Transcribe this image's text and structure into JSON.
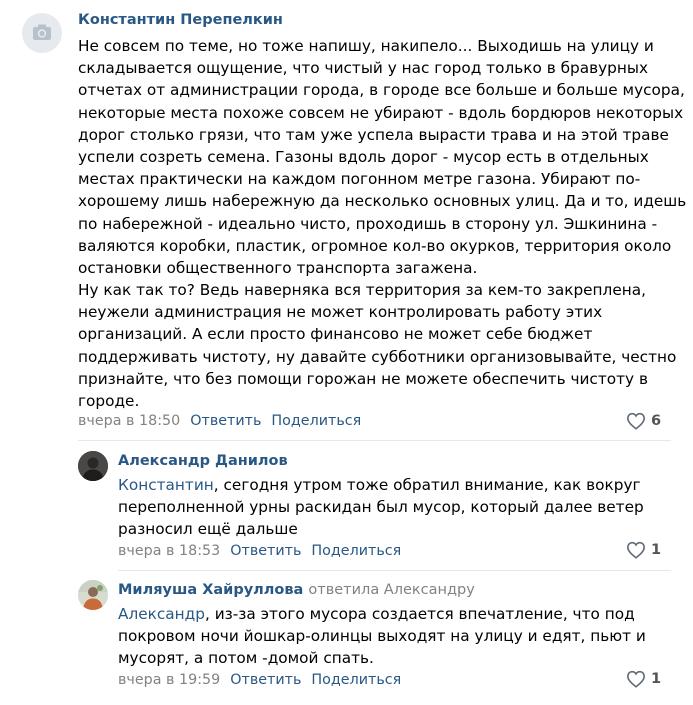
{
  "colors": {
    "link": "#2a5885",
    "meta": "#828282",
    "divider": "#e7e8ec"
  },
  "comments": [
    {
      "author": "Константин Перепелкин",
      "avatar_icon": "camera-icon",
      "text_lines": [
        "Не совсем по теме, но тоже напишу, накипело... Выходишь на улицу и",
        "складывается ощущение, что чистый у нас город только в бравурных",
        "отчетах от администрации города, в городе все больше и больше мусора,",
        "некоторые места похоже совсем не убирают - вдоль бордюров некоторых",
        "дорог столько грязи, что там уже успела вырасти трава и на этой траве",
        "успели созреть семена. Газоны вдоль дорог - мусор есть в отдельных",
        "местах практически на каждом погонном метре газона. Убирают по-",
        "хорошему лишь набережную да несколько основных улиц. Да и то, идешь",
        "по набережной - идеально чисто, проходишь в сторону ул. Эшкинина -",
        "валяются коробки, пластик, огромное кол-во окурков, территория около",
        "остановки общественного транспорта загажена.",
        "Ну как так то? Ведь наверняка вся территория за кем-то закреплена,",
        "неужели администрация не может контролировать работу этих",
        "организаций. А если просто финансово не может себе бюджет",
        "поддерживать чистоту, ну давайте субботники организовывайте, честно",
        "признайте, что без помощи горожан не можете обеспечить чистоту в",
        "городе."
      ],
      "date": "вчера в 18:50",
      "reply_label": "Ответить",
      "share_label": "Поделиться",
      "likes": "6"
    },
    {
      "author": "Александр Данилов",
      "avatar_icon": "user-photo",
      "mention": "Константин",
      "text_first_rest": ", сегодня утром тоже обратил внимание, как вокруг",
      "text_lines": [
        "переполненной урны раскидан был мусор, который далее ветер",
        "разносил ещё дальше"
      ],
      "date": "вчера в 18:53",
      "reply_label": "Ответить",
      "share_label": "Поделиться",
      "likes": "1"
    },
    {
      "author": "Миляуша Хайруллова",
      "reply_to": "ответила Александру",
      "avatar_icon": "user-photo",
      "mention": "Александр",
      "text_first_rest": ", из-за этого мусора создается впечатление, что под",
      "text_lines": [
        "покровом ночи йошкар-олинцы выходят на улицу и едят, пьют и",
        "мусорят, а потом -домой спать."
      ],
      "date": "вчера в 19:59",
      "reply_label": "Ответить",
      "share_label": "Поделиться",
      "likes": "1"
    }
  ]
}
